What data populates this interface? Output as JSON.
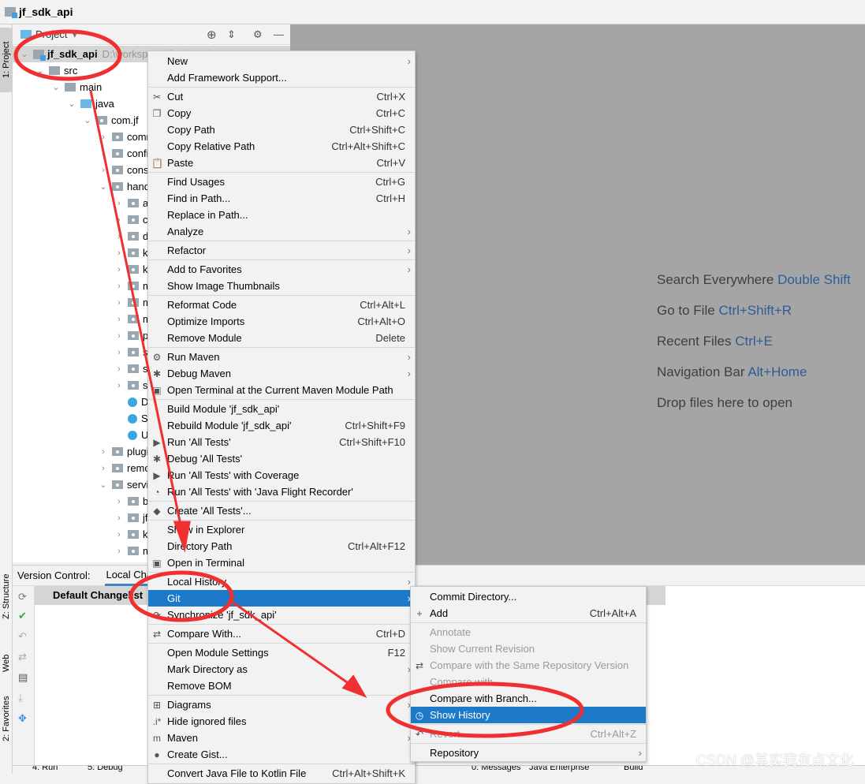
{
  "window": {
    "title": "jf_sdk_api"
  },
  "side_tabs": {
    "project": "1: Project",
    "structure": "Z: Structure",
    "web": "Web",
    "favorites": "2: Favorites"
  },
  "project_panel": {
    "view_label": "Project",
    "root": {
      "name": "jf_sdk_api",
      "path": "D:\\workspace\\jf\\sdk_api"
    },
    "tree": [
      {
        "label": "src",
        "depth": 1,
        "type": "folder",
        "open": true
      },
      {
        "label": "main",
        "depth": 2,
        "type": "folder",
        "open": true
      },
      {
        "label": "java",
        "depth": 3,
        "type": "src",
        "open": true
      },
      {
        "label": "com.jf",
        "depth": 4,
        "type": "pkg",
        "open": true
      },
      {
        "label": "comm",
        "depth": 5,
        "type": "pkg",
        "open": false
      },
      {
        "label": "config",
        "depth": 5,
        "type": "pkg",
        "open": false
      },
      {
        "label": "const",
        "depth": 5,
        "type": "pkg",
        "open": false
      },
      {
        "label": "hand",
        "depth": 5,
        "type": "pkg",
        "open": true
      },
      {
        "label": "an",
        "depth": 6,
        "type": "pkg",
        "open": false
      },
      {
        "label": "co",
        "depth": 6,
        "type": "pkg",
        "open": false
      },
      {
        "label": "da",
        "depth": 6,
        "type": "pkg",
        "open": false
      },
      {
        "label": "ke",
        "depth": 6,
        "type": "pkg",
        "open": false
      },
      {
        "label": "kf",
        "depth": 6,
        "type": "pkg",
        "open": false
      },
      {
        "label": "m",
        "depth": 6,
        "type": "pkg",
        "open": false
      },
      {
        "label": "m",
        "depth": 6,
        "type": "pkg",
        "open": false
      },
      {
        "label": "m",
        "depth": 6,
        "type": "pkg",
        "open": false
      },
      {
        "label": "pa",
        "depth": 6,
        "type": "pkg",
        "open": false
      },
      {
        "label": "sc",
        "depth": 6,
        "type": "pkg",
        "open": false
      },
      {
        "label": "st",
        "depth": 6,
        "type": "pkg",
        "open": false
      },
      {
        "label": "sy",
        "depth": 6,
        "type": "pkg",
        "open": false
      },
      {
        "label": "D",
        "depth": 6,
        "type": "class"
      },
      {
        "label": "Se",
        "depth": 6,
        "type": "class"
      },
      {
        "label": "U",
        "depth": 6,
        "type": "class"
      },
      {
        "label": "plugi",
        "depth": 5,
        "type": "pkg",
        "open": false
      },
      {
        "label": "remo",
        "depth": 5,
        "type": "pkg",
        "open": false
      },
      {
        "label": "servi",
        "depth": 5,
        "type": "pkg",
        "open": true
      },
      {
        "label": "ba",
        "depth": 6,
        "type": "pkg",
        "open": false
      },
      {
        "label": "jf",
        "depth": 6,
        "type": "pkg",
        "open": false
      },
      {
        "label": "kf",
        "depth": 6,
        "type": "pkg",
        "open": false
      },
      {
        "label": "m",
        "depth": 6,
        "type": "pkg",
        "open": false
      }
    ]
  },
  "editor_hints": [
    {
      "text": "Search Everywhere",
      "key": "Double Shift"
    },
    {
      "text": "Go to File",
      "key": "Ctrl+Shift+R"
    },
    {
      "text": "Recent Files",
      "key": "Ctrl+E"
    },
    {
      "text": "Navigation Bar",
      "key": "Alt+Home"
    },
    {
      "text": "Drop files here to open",
      "key": ""
    }
  ],
  "version_control": {
    "label": "Version Control:",
    "tab": "Local Changes",
    "changelist": "Default Changelist"
  },
  "status_bar": [
    "4: Run",
    "5: Debug",
    "0: Messages",
    "Java Enterprise",
    "Build"
  ],
  "context_menu": [
    {
      "label": "New",
      "submenu": true
    },
    {
      "label": "Add Framework Support..."
    },
    {
      "sep": true
    },
    {
      "label": "Cut",
      "icon": "✂",
      "shortcut": "Ctrl+X",
      "iname": "scissors-icon"
    },
    {
      "label": "Copy",
      "icon": "❐",
      "shortcut": "Ctrl+C",
      "iname": "copy-icon"
    },
    {
      "label": "Copy Path",
      "shortcut": "Ctrl+Shift+C"
    },
    {
      "label": "Copy Relative Path",
      "shortcut": "Ctrl+Alt+Shift+C"
    },
    {
      "label": "Paste",
      "icon": "📋",
      "shortcut": "Ctrl+V",
      "iname": "clipboard-icon"
    },
    {
      "sep": true
    },
    {
      "label": "Find Usages",
      "shortcut": "Ctrl+G"
    },
    {
      "label": "Find in Path...",
      "shortcut": "Ctrl+H"
    },
    {
      "label": "Replace in Path..."
    },
    {
      "label": "Analyze",
      "submenu": true
    },
    {
      "sep": true
    },
    {
      "label": "Refactor",
      "submenu": true
    },
    {
      "sep": true
    },
    {
      "label": "Add to Favorites",
      "submenu": true
    },
    {
      "label": "Show Image Thumbnails"
    },
    {
      "sep": true
    },
    {
      "label": "Reformat Code",
      "shortcut": "Ctrl+Alt+L"
    },
    {
      "label": "Optimize Imports",
      "shortcut": "Ctrl+Alt+O"
    },
    {
      "label": "Remove Module",
      "shortcut": "Delete"
    },
    {
      "sep": true
    },
    {
      "label": "Run Maven",
      "icon": "⚙",
      "submenu": true,
      "iname": "maven-run-icon"
    },
    {
      "label": "Debug Maven",
      "icon": "✱",
      "submenu": true,
      "iname": "maven-debug-icon"
    },
    {
      "label": "Open Terminal at the Current Maven Module Path",
      "icon": "▣",
      "iname": "terminal-icon"
    },
    {
      "sep": true
    },
    {
      "label": "Build Module 'jf_sdk_api'"
    },
    {
      "label": "Rebuild Module 'jf_sdk_api'",
      "shortcut": "Ctrl+Shift+F9"
    },
    {
      "label": "Run 'All Tests'",
      "icon": "▶",
      "shortcut": "Ctrl+Shift+F10",
      "iname": "run-icon"
    },
    {
      "label": "Debug 'All Tests'",
      "icon": "✱",
      "iname": "debug-icon"
    },
    {
      "label": "Run 'All Tests' with Coverage",
      "icon": "▶",
      "iname": "coverage-icon"
    },
    {
      "label": "Run 'All Tests' with 'Java Flight Recorder'",
      "icon": "◔",
      "iname": "profiler-icon"
    },
    {
      "sep": true
    },
    {
      "label": "Create 'All Tests'...",
      "icon": "◆",
      "iname": "create-test-icon"
    },
    {
      "sep": true
    },
    {
      "label": "Show in Explorer"
    },
    {
      "label": "Directory Path",
      "shortcut": "Ctrl+Alt+F12"
    },
    {
      "label": "Open in Terminal",
      "icon": "▣",
      "iname": "terminal-icon"
    },
    {
      "sep": true
    },
    {
      "label": "Local History",
      "submenu": true
    },
    {
      "label": "Git",
      "submenu": true,
      "highlighted": true
    },
    {
      "label": "Synchronize 'jf_sdk_api'",
      "icon": "⟳",
      "iname": "sync-icon"
    },
    {
      "sep": true
    },
    {
      "label": "Compare With...",
      "icon": "⇄",
      "shortcut": "Ctrl+D",
      "iname": "compare-icon"
    },
    {
      "sep": true
    },
    {
      "label": "Open Module Settings",
      "shortcut": "F12"
    },
    {
      "label": "Mark Directory as",
      "submenu": true
    },
    {
      "label": "Remove BOM"
    },
    {
      "sep": true
    },
    {
      "label": "Diagrams",
      "icon": "⊞",
      "submenu": true,
      "iname": "diagram-icon"
    },
    {
      "label": "Hide ignored files",
      "icon": ".i*",
      "iname": "ignore-icon"
    },
    {
      "label": "Maven",
      "icon": "m",
      "submenu": true,
      "iname": "maven-icon"
    },
    {
      "label": "Create Gist...",
      "icon": "●",
      "iname": "github-icon"
    },
    {
      "sep": true
    },
    {
      "label": "Convert Java File to Kotlin File",
      "shortcut": "Ctrl+Alt+Shift+K"
    }
  ],
  "git_submenu": [
    {
      "label": "Commit Directory..."
    },
    {
      "label": "Add",
      "icon": "+",
      "shortcut": "Ctrl+Alt+A",
      "iname": "plus-icon"
    },
    {
      "sep": true
    },
    {
      "label": "Annotate",
      "disabled": true
    },
    {
      "label": "Show Current Revision",
      "disabled": true
    },
    {
      "label": "Compare with the Same Repository Version",
      "icon": "⇄",
      "disabled": true,
      "iname": "compare-icon"
    },
    {
      "label": "Compare with...",
      "disabled": true
    },
    {
      "label": "Compare with Branch..."
    },
    {
      "label": "Show History",
      "icon": "◷",
      "highlighted": true,
      "iname": "clock-icon"
    },
    {
      "sep": true
    },
    {
      "label": "Revert...",
      "icon": "↶",
      "shortcut": "Ctrl+Alt+Z",
      "disabled": true,
      "iname": "revert-icon"
    },
    {
      "sep": true
    },
    {
      "label": "Repository",
      "submenu": true
    }
  ],
  "watermark": "CSDN @其实我有点文化",
  "colors": {
    "highlight": "#1d7ac8",
    "annotation": "#f03030",
    "editor_bg": "#a5a5a5"
  }
}
